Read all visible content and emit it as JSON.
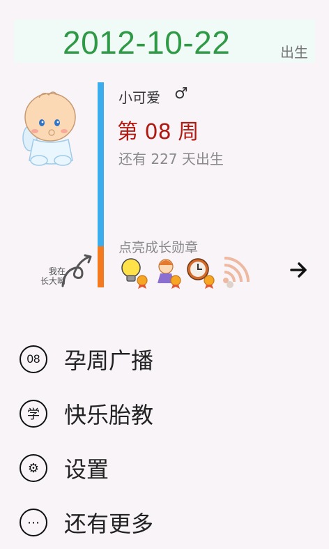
{
  "header": {
    "date": "2012-10-22",
    "date_suffix": "出生"
  },
  "profile": {
    "name": "小可爱",
    "gender_symbol": "♂",
    "week_label": "第 08 周",
    "countdown": "还有 227 天出生",
    "grow_note_line1": "我在",
    "grow_note_line2": "长大呦",
    "progress_fraction": 0.2
  },
  "badges": {
    "title": "点亮成长勋章",
    "items": [
      {
        "icon": "lightbulb-badge-icon"
      },
      {
        "icon": "girl-badge-icon"
      },
      {
        "icon": "clock-badge-icon"
      },
      {
        "icon": "rss-badge-icon"
      }
    ],
    "next_icon": "arrow-right-icon"
  },
  "menu": {
    "items": [
      {
        "icon_text": "08",
        "label": "孕周广播"
      },
      {
        "icon_text": "学",
        "label": "快乐胎教"
      },
      {
        "icon_text": "⚙",
        "label": "设置"
      },
      {
        "icon_text": "⋯",
        "label": "还有更多"
      }
    ]
  },
  "colors": {
    "date": "#2f9a46",
    "week": "#b1180f",
    "progress_track": "#3badec",
    "progress_fill": "#f47a20"
  }
}
